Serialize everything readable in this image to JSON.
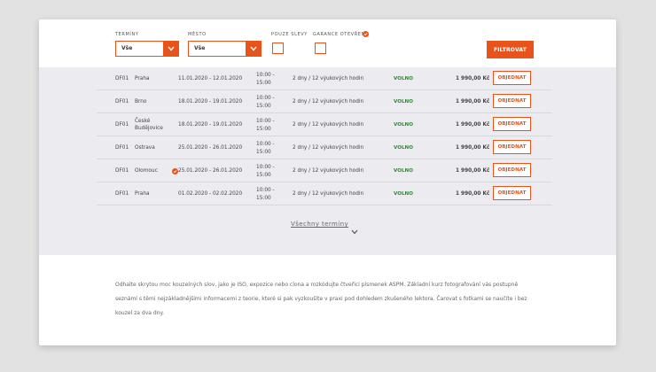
{
  "filters": {
    "terms_label": "TERMÍNY",
    "terms_value": "Vše",
    "city_label": "MĚSTO",
    "city_value": "Vše",
    "discount_label": "POUZE SLEVY",
    "guarantee_label": "GARANCE OTEVŘENÍ",
    "filter_button": "FILTROVAT"
  },
  "rows": [
    {
      "code": "DF01",
      "city": "Praha",
      "date": "11.01.2020 - 12.01.2020",
      "time": "10:00 -\n15:00",
      "duration": "2 dny / 12 výukových hodin",
      "status": "VOLNO",
      "price": "1 990,00 Kč",
      "order": "OBJEDNAT"
    },
    {
      "code": "DF01",
      "city": "Brno",
      "date": "18.01.2020 - 19.01.2020",
      "time": "10:00 -\n15:00",
      "duration": "2 dny / 12 výukových hodin",
      "status": "VOLNO",
      "price": "1 990,00 Kč",
      "order": "OBJEDNAT"
    },
    {
      "code": "DF01",
      "city": "České\nBudějovice",
      "date": "18.01.2020 - 19.01.2020",
      "time": "10:00 -\n15:00",
      "duration": "2 dny / 12 výukových hodin",
      "status": "VOLNO",
      "price": "1 990,00 Kč",
      "order": "OBJEDNAT"
    },
    {
      "code": "DF01",
      "city": "Ostrava",
      "date": "25.01.2020 - 26.01.2020",
      "time": "10:00 -\n15:00",
      "duration": "2 dny / 12 výukových hodin",
      "status": "VOLNO",
      "price": "1 990,00 Kč",
      "order": "OBJEDNAT"
    },
    {
      "code": "DF01",
      "city": "Olomouc",
      "date": "25.01.2020 - 26.01.2020",
      "time": "10:00 -\n15:00",
      "duration": "2 dny / 12 výukových hodin",
      "status": "VOLNO",
      "price": "1 990,00 Kč",
      "order": "OBJEDNAT"
    },
    {
      "code": "DF01",
      "city": "Praha",
      "date": "01.02.2020 - 02.02.2020",
      "time": "10:00 -\n15:00",
      "duration": "2 dny / 12 výukových hodin",
      "status": "VOLNO",
      "price": "1 990,00 Kč",
      "order": "OBJEDNAT"
    }
  ],
  "all_terms_link": "Všechny termíny",
  "description": "Odhalte skrytou moc kouzelných slov, jako je ISO, expozice nebo clona a rozkódujte čtveřici písmenek ASPM. Základní kurz fotografování vás postupně seznámí s těmi nejzákladnějšími informacemi z teorie, které si pak vyzkoušíte v praxi pod dohledem zkušeného lektora. Čarovat s fotkami se naučíte i bez kouzel za dva dny.",
  "colors": {
    "accent": "#e8531c",
    "status_free": "#2e8b2e",
    "panel": "#ececf0"
  }
}
